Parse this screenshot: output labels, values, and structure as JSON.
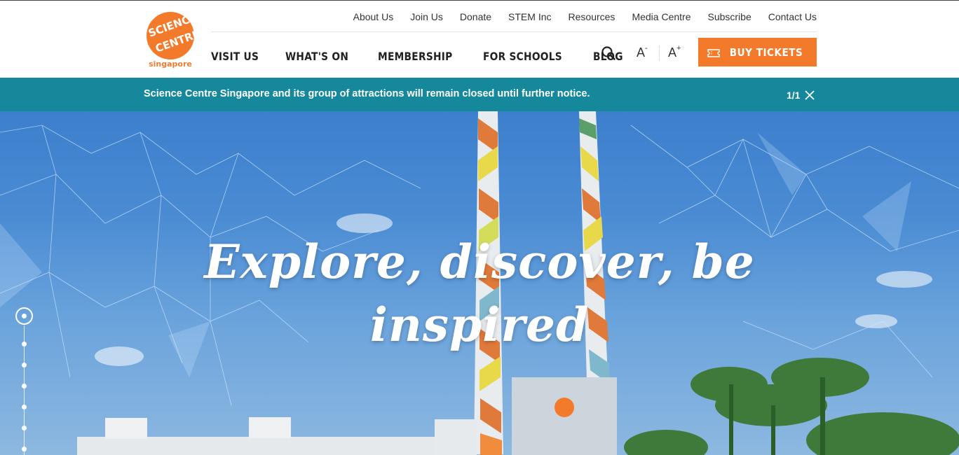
{
  "brand": {
    "logo_word": "SCIENCE CENTRE",
    "logo_sub": "singapore",
    "accent": "#f47a2b",
    "teal": "#15889b"
  },
  "utility_nav": [
    {
      "label": "About Us"
    },
    {
      "label": "Join Us"
    },
    {
      "label": "Donate"
    },
    {
      "label": "STEM Inc"
    },
    {
      "label": "Resources"
    },
    {
      "label": "Media Centre"
    },
    {
      "label": "Subscribe"
    },
    {
      "label": "Contact Us"
    }
  ],
  "main_nav": [
    {
      "label": "VISIT US"
    },
    {
      "label": "WHAT'S ON"
    },
    {
      "label": "MEMBERSHIP"
    },
    {
      "label": "FOR SCHOOLS"
    },
    {
      "label": "BLOG"
    }
  ],
  "tools": {
    "search_icon": "search-icon",
    "font_decrease": "A",
    "font_decrease_sign": "-",
    "font_increase": "A",
    "font_increase_sign": "+"
  },
  "buy_tickets": {
    "label": "BUY TICKETS",
    "icon": "ticket-icon"
  },
  "alert": {
    "message": "Science Centre Singapore and its group of attractions will remain closed until further notice.",
    "counter": "1/1"
  },
  "hero": {
    "title_line1": "Explore, discover, be",
    "title_line2": "inspired"
  }
}
